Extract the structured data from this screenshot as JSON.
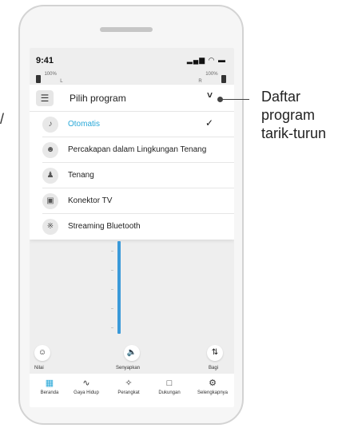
{
  "status_bar": {
    "time": "9:41",
    "system_icons": "▂▄▆ ◠ ▬",
    "battery_left_pct": "100%",
    "battery_left_side": "L",
    "battery_right_pct": "100%",
    "battery_right_side": "R"
  },
  "dropdown": {
    "title": "Pilih program",
    "chevron": "˅",
    "items": [
      {
        "label": "Otomatis",
        "icon": "auto-icon",
        "selected": true
      },
      {
        "label": "Percakapan dalam Lingkungan Tenang",
        "icon": "conversation-icon",
        "selected": false
      },
      {
        "label": "Tenang",
        "icon": "quiet-icon",
        "selected": false
      },
      {
        "label": "Konektor TV",
        "icon": "tv-icon",
        "selected": false
      },
      {
        "label": "Streaming Bluetooth",
        "icon": "bluetooth-icon",
        "selected": false
      }
    ]
  },
  "actions": [
    {
      "label": "Nilai",
      "icon": "smile-icon"
    },
    {
      "label": "Senyapkan",
      "icon": "speaker-icon"
    },
    {
      "label": "Bagi",
      "icon": "split-icon"
    }
  ],
  "nav": [
    {
      "label": "Beranda",
      "icon": "grid-icon",
      "active": true
    },
    {
      "label": "Gaya Hidup",
      "icon": "pulse-icon",
      "active": false
    },
    {
      "label": "Perangkat",
      "icon": "hearing-aid-icon",
      "active": false
    },
    {
      "label": "Dukungan",
      "icon": "chat-icon",
      "active": false
    },
    {
      "label": "Selengkapnya",
      "icon": "gear-icon",
      "active": false
    }
  ],
  "callout": {
    "line1": "Daftar",
    "line2": "program",
    "line3": "tarik-turun"
  },
  "edge_mark": "/",
  "colors": {
    "accent": "#29a8d8",
    "slider": "#3b9ad9"
  }
}
